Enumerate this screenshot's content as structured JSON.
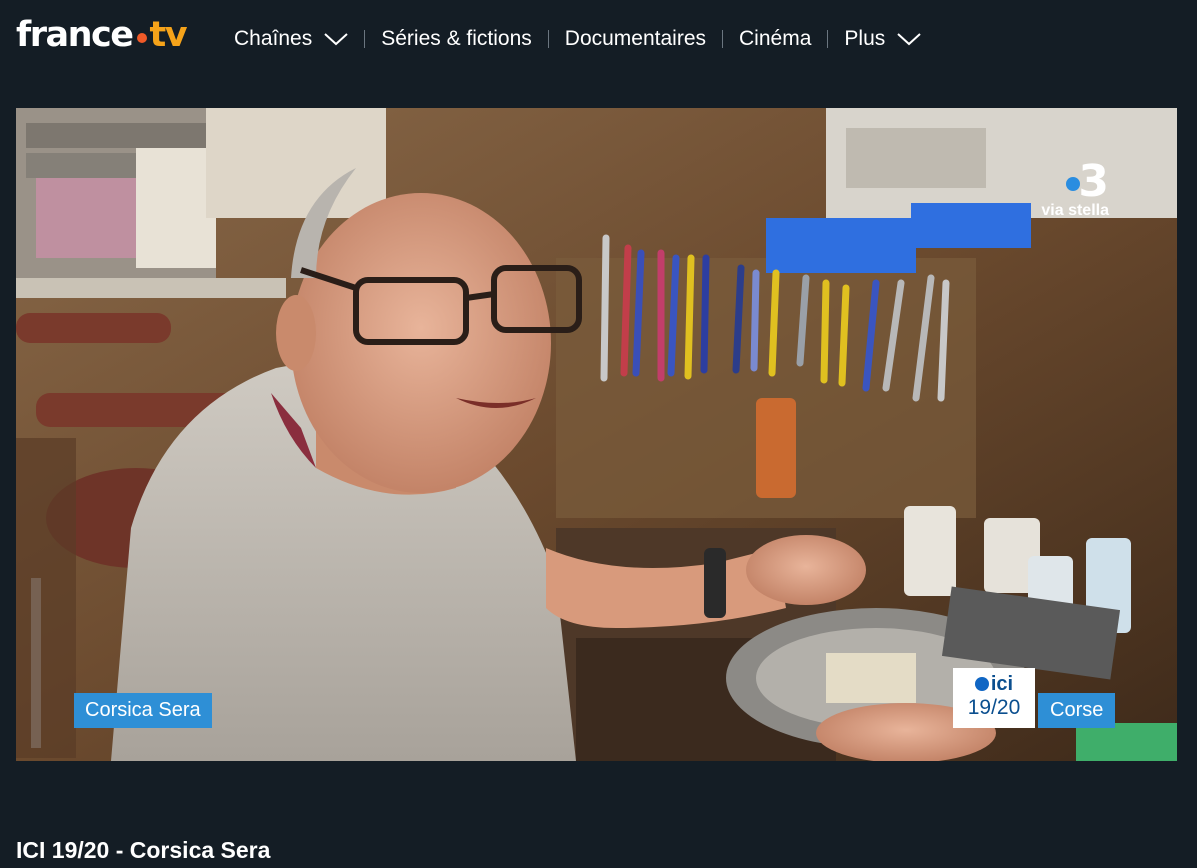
{
  "header": {
    "logo": {
      "main": "france",
      "accent": "tv"
    },
    "nav": [
      {
        "label": "Chaînes",
        "has_dropdown": true
      },
      {
        "label": "Séries & fictions",
        "has_dropdown": false
      },
      {
        "label": "Documentaires",
        "has_dropdown": false
      },
      {
        "label": "Cinéma",
        "has_dropdown": false
      },
      {
        "label": "Plus",
        "has_dropdown": true
      }
    ]
  },
  "player": {
    "channel_logo": {
      "number": "3",
      "subtitle": "via stella"
    },
    "lower_third_left": "Corsica Sera",
    "program_badge": {
      "brand": "ici",
      "time": "19/20"
    },
    "lower_third_right": "Corse"
  },
  "program": {
    "title": "ICI 19/20 - Corsica Sera"
  },
  "colors": {
    "background": "#141d25",
    "accent_blue": "#2e8fd6",
    "logo_dot": "#f05a28",
    "logo_tv": "#f5a31a"
  }
}
